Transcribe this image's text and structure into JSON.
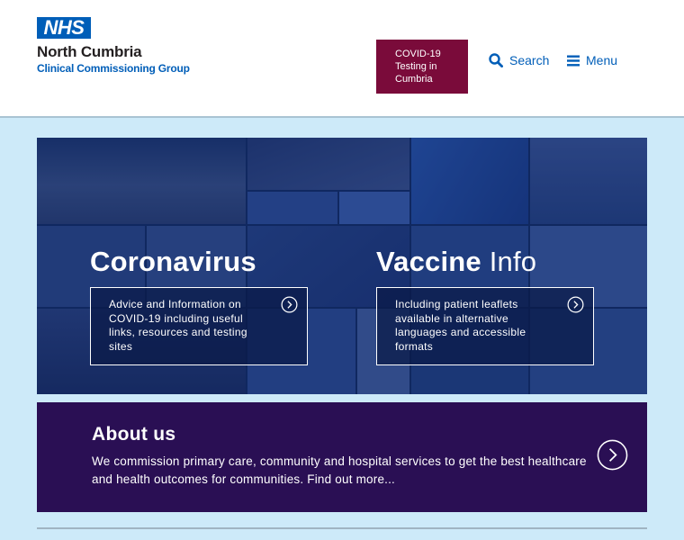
{
  "header": {
    "nhs_badge": "NHS",
    "org_name": "North Cumbria",
    "org_subtitle": "Clinical Commissioning Group",
    "covid_button_lines": [
      "COVID-19",
      "Testing in",
      "Cumbria"
    ],
    "search_label": "Search",
    "menu_label": "Menu"
  },
  "hero": {
    "features": [
      {
        "title": "Coronavirus",
        "title_light": "",
        "description": "Advice and Information on COVID-19 including useful links, resources and testing sites"
      },
      {
        "title": "Vaccine",
        "title_light": "Info",
        "description": "Including patient leaflets available in alternative languages and accessible formats"
      }
    ]
  },
  "about": {
    "title": "About us",
    "description": "We commission primary care, community and hospital services to get the best healthcare and health outcomes for communities. Find out more..."
  },
  "icons": {
    "search": "search-icon",
    "menu": "hamburger-icon",
    "chevron": "chevron-right-circle-icon"
  },
  "colors": {
    "nhs_blue": "#005eb8",
    "covid_button": "#7a0b3a",
    "about_panel": "#2a0f54",
    "page_background": "#cdeaf9"
  }
}
